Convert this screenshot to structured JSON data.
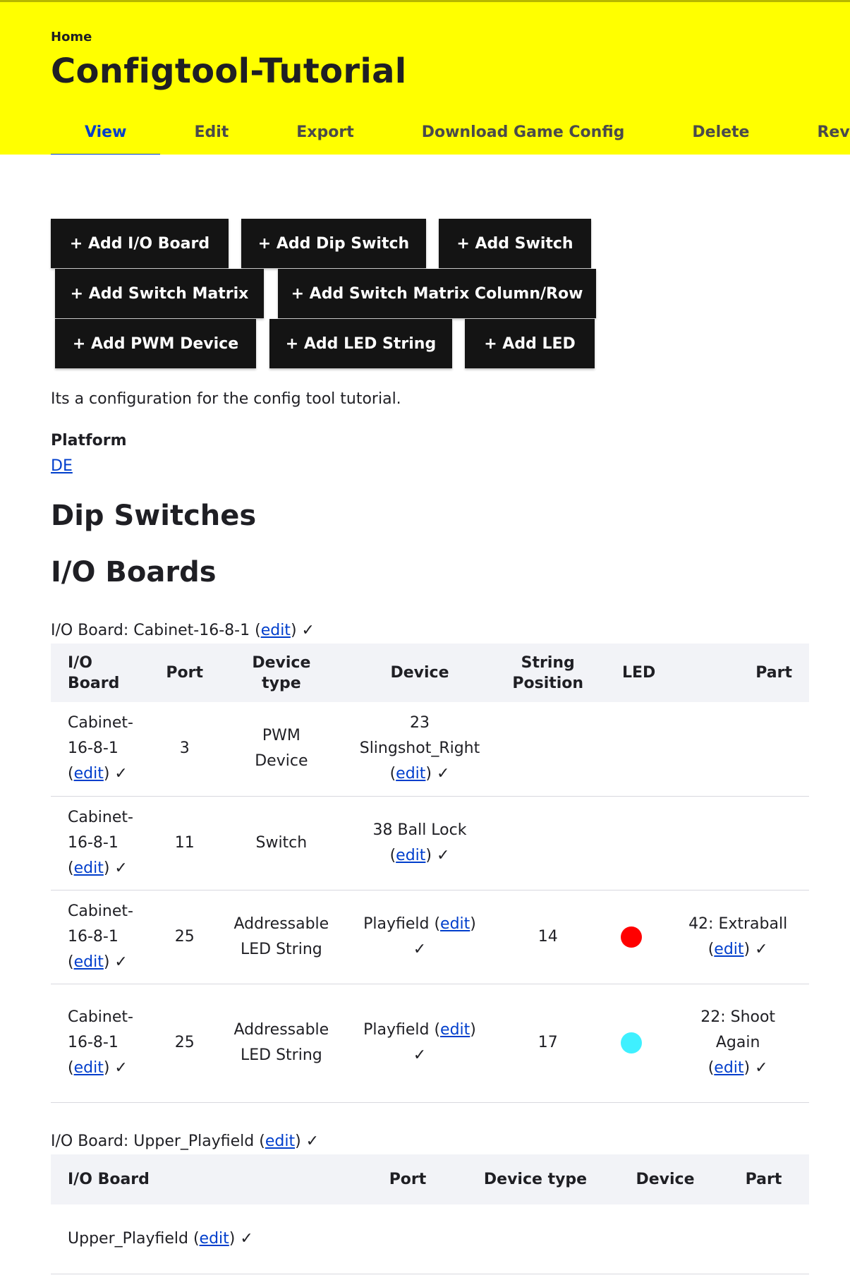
{
  "header": {
    "breadcrumb": "Home",
    "title": "Configtool-Tutorial",
    "tabs": [
      "View",
      "Edit",
      "Export",
      "Download Game Config",
      "Delete",
      "Revisions"
    ],
    "active_tab": "View"
  },
  "buttons": [
    "+ Add I/O Board",
    "+ Add Dip Switch",
    "+ Add Switch",
    "+ Add Switch Matrix",
    "+ Add Switch Matrix Column/Row",
    "+ Add PWM Device",
    "+ Add LED String",
    "+ Add LED"
  ],
  "description": "Its a configuration for the config tool tutorial.",
  "platform": {
    "label": "Platform",
    "value": "DE"
  },
  "sections": {
    "dip_switches": "Dip Switches",
    "io_boards": "I/O Boards"
  },
  "edit_label": "edit",
  "check": "✓",
  "board1": {
    "caption_prefix": "I/O Board: ",
    "name": "Cabinet-16-8-1",
    "headers": [
      "I/O Board",
      "Port",
      "Device type",
      "Device",
      "String Position",
      "LED",
      "Part"
    ],
    "rows": [
      {
        "board": "Cabinet-16-8-1",
        "port": "3",
        "device_type": "PWM Device",
        "device": "23 Slingshot_Right",
        "string_position": "",
        "led_color": "",
        "part": ""
      },
      {
        "board": "Cabinet-16-8-1",
        "port": "11",
        "device_type": "Switch",
        "device": "38 Ball Lock",
        "string_position": "",
        "led_color": "",
        "part": ""
      },
      {
        "board": "Cabinet-16-8-1",
        "port": "25",
        "device_type": "Addressable LED String",
        "device": "Playfield",
        "string_position": "14",
        "led_color": "#ff0000",
        "part": "42: Extraball"
      },
      {
        "board": "Cabinet-16-8-1",
        "port": "25",
        "device_type": "Addressable LED String",
        "device": "Playfield",
        "string_position": "17",
        "led_color": "#3ff0ff",
        "part": "22: Shoot Again"
      }
    ]
  },
  "board2": {
    "caption_prefix": "I/O Board: ",
    "name": "Upper_Playfield",
    "headers": [
      "I/O Board",
      "Port",
      "Device type",
      "Device",
      "Part"
    ],
    "rows": [
      {
        "board": "Upper_Playfield",
        "port": "",
        "device_type": "",
        "device": "",
        "part": ""
      }
    ]
  }
}
